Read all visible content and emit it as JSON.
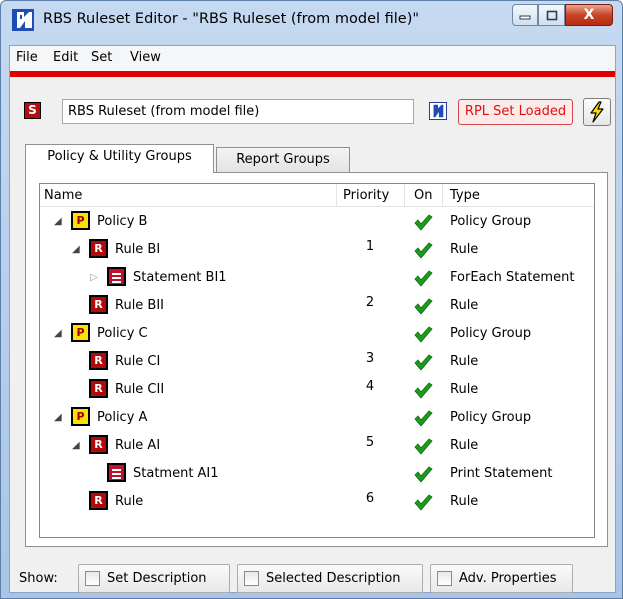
{
  "window": {
    "title": "RBS Ruleset Editor - \"RBS Ruleset (from model file)\"",
    "close_glyph": "X"
  },
  "menu": [
    "File",
    "Edit",
    "Set",
    "View"
  ],
  "toolbar": {
    "set_icon_letter": "S",
    "ruleset_name": "RBS Ruleset (from model file)",
    "status_button": "RPL Set Loaded"
  },
  "tabs": [
    "Policy & Utility Groups",
    "Report Groups"
  ],
  "tree": {
    "columns": [
      "Name",
      "Priority",
      "On",
      "Type"
    ],
    "rows": [
      {
        "kind": "policy",
        "icon_letter": "P",
        "name": "Policy B",
        "priority": "",
        "on": true,
        "type": "Policy Group",
        "expander": "expanded"
      },
      {
        "kind": "rule",
        "icon_letter": "R",
        "name": "Rule BI",
        "priority": "1",
        "on": true,
        "type": "Rule",
        "expander": "expanded"
      },
      {
        "kind": "statement",
        "icon_letter": "",
        "name": "Statement BI1",
        "priority": "",
        "on": true,
        "type": "ForEach Statement",
        "expander": "collapsed"
      },
      {
        "kind": "rule",
        "icon_letter": "R",
        "name": "Rule BII",
        "priority": "2",
        "on": true,
        "type": "Rule",
        "expander": "none"
      },
      {
        "kind": "policy",
        "icon_letter": "P",
        "name": "Policy C",
        "priority": "",
        "on": true,
        "type": "Policy Group",
        "expander": "expanded"
      },
      {
        "kind": "rule",
        "icon_letter": "R",
        "name": "Rule CI",
        "priority": "3",
        "on": true,
        "type": "Rule",
        "expander": "none"
      },
      {
        "kind": "rule",
        "icon_letter": "R",
        "name": "Rule CII",
        "priority": "4",
        "on": true,
        "type": "Rule",
        "expander": "none"
      },
      {
        "kind": "policy",
        "icon_letter": "P",
        "name": "Policy A",
        "priority": "",
        "on": true,
        "type": "Policy Group",
        "expander": "expanded"
      },
      {
        "kind": "rule",
        "icon_letter": "R",
        "name": "Rule AI",
        "priority": "5",
        "on": true,
        "type": "Rule",
        "expander": "expanded"
      },
      {
        "kind": "statement",
        "icon_letter": "",
        "name": "Statment AI1",
        "priority": "",
        "on": true,
        "type": "Print Statement",
        "expander": "none"
      },
      {
        "kind": "rule",
        "icon_letter": "R",
        "name": "Rule",
        "priority": "6",
        "on": true,
        "type": "Rule",
        "expander": "none"
      }
    ]
  },
  "show_bar": {
    "label": "Show:",
    "options": [
      {
        "label": "Set Description",
        "checked": false
      },
      {
        "label": "Selected Description",
        "checked": false
      },
      {
        "label": "Adv. Properties",
        "checked": false
      }
    ]
  },
  "colors": {
    "accent_red": "#e00000",
    "check_green": "#1e9a1e",
    "status_text": "#e01010"
  },
  "icons": {
    "app": "rbs-app-icon",
    "reload": "reload-from-model-icon",
    "execute": "lightning-bolt-icon",
    "enabled": "green-check-icon"
  }
}
